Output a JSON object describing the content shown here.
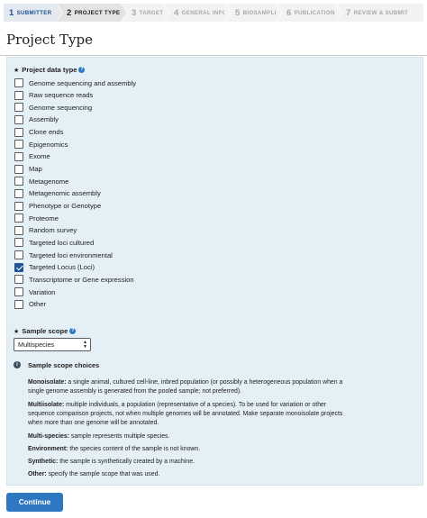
{
  "stepper": [
    {
      "num": "1",
      "label": "SUBMITTER",
      "state": "done"
    },
    {
      "num": "2",
      "label": "PROJECT TYPE",
      "state": "current"
    },
    {
      "num": "3",
      "label": "TARGET",
      "state": "upcoming"
    },
    {
      "num": "4",
      "label": "GENERAL INFO",
      "state": "upcoming"
    },
    {
      "num": "5",
      "label": "BIOSAMPLE",
      "state": "upcoming"
    },
    {
      "num": "6",
      "label": "PUBLICATIONS",
      "state": "upcoming"
    },
    {
      "num": "7",
      "label": "REVIEW & SUBMIT",
      "state": "upcoming"
    }
  ],
  "page_title": "Project Type",
  "data_type": {
    "label": "Project data type",
    "options": [
      {
        "label": "Genome sequencing and assembly",
        "checked": false
      },
      {
        "label": "Raw sequence reads",
        "checked": false
      },
      {
        "label": "Genome sequencing",
        "checked": false
      },
      {
        "label": "Assembly",
        "checked": false
      },
      {
        "label": "Clone ends",
        "checked": false
      },
      {
        "label": "Epigenomics",
        "checked": false
      },
      {
        "label": "Exome",
        "checked": false
      },
      {
        "label": "Map",
        "checked": false
      },
      {
        "label": "Metagenome",
        "checked": false
      },
      {
        "label": "Metagenomic assembly",
        "checked": false
      },
      {
        "label": "Phenotype or Genotype",
        "checked": false
      },
      {
        "label": "Proteome",
        "checked": false
      },
      {
        "label": "Random survey",
        "checked": false
      },
      {
        "label": "Targeted loci cultured",
        "checked": false
      },
      {
        "label": "Targeted loci environmental",
        "checked": false
      },
      {
        "label": "Targeted Locus (Loci)",
        "checked": true
      },
      {
        "label": "Transcriptome or Gene expression",
        "checked": false
      },
      {
        "label": "Variation",
        "checked": false
      },
      {
        "label": "Other",
        "checked": false
      }
    ]
  },
  "sample_scope": {
    "label": "Sample scope",
    "selected": "Multispecies"
  },
  "scope_info": {
    "title": "Sample scope choices",
    "items": [
      {
        "term": "Monoisolate:",
        "text": " a single animal, cultured cell-line, inbred population (or possibly a heterogeneous population when a single genome assembly is generated from the pooled sample; not preferred)."
      },
      {
        "term": "Multiisolate:",
        "text": " multiple individuals, a population (representative of a species). To be used for variation or other sequence comparison projects, not when multiple genomes will be annotated. Make separate monoisolate projects when more than one genome will be annotated."
      },
      {
        "term": "Multi-species:",
        "text": " sample represents multiple species."
      },
      {
        "term": "Environment:",
        "text": " the species content of the sample is not known."
      },
      {
        "term": "Synthetic:",
        "text": " the sample is synthetically created by a machine."
      },
      {
        "term": "Other:",
        "text": " specify the sample scope that was used."
      }
    ]
  },
  "continue_label": "Continue",
  "colors": {
    "accent": "#2e78c2",
    "panel": "#e5f0f6",
    "done_step": "#205493"
  }
}
